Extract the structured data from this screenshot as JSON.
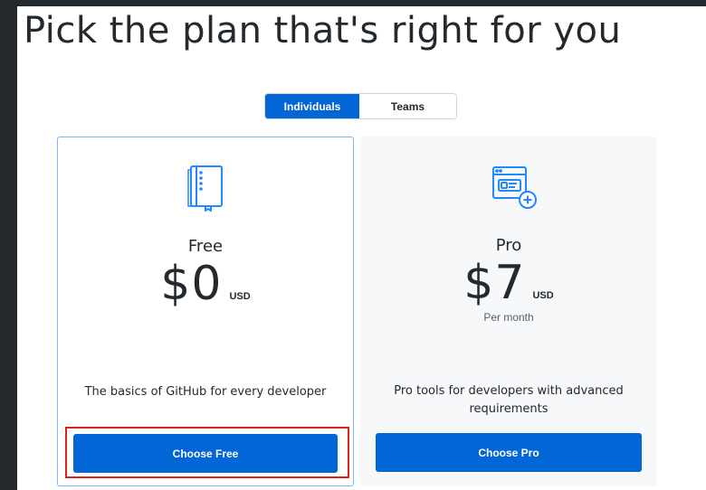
{
  "page": {
    "title": "Pick the plan that's right for you"
  },
  "toggle": {
    "options": [
      {
        "label": "Individuals",
        "selected": true
      },
      {
        "label": "Teams",
        "selected": false
      }
    ]
  },
  "plans": [
    {
      "name": "Free",
      "price": "$0",
      "currency": "USD",
      "period": "",
      "description": "The basics of GitHub for every developer",
      "cta": "Choose Free",
      "icon": "book-icon"
    },
    {
      "name": "Pro",
      "price": "$7",
      "currency": "USD",
      "period": "Per month",
      "description": "Pro tools for developers with advanced requirements",
      "cta": "Choose Pro",
      "icon": "id-card-plus-icon"
    }
  ],
  "colors": {
    "accent": "#0366d6",
    "icon_blue": "#2188ff",
    "highlight": "#e0201d",
    "backdrop": "#24292e"
  }
}
